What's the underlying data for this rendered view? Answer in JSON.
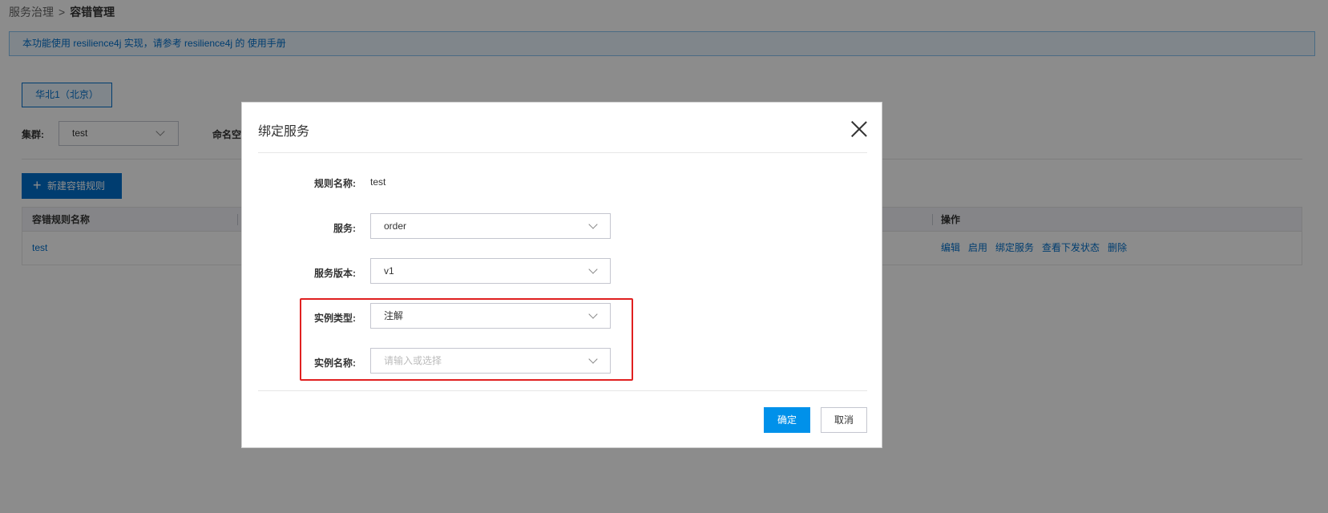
{
  "breadcrumb": {
    "parent": "服务治理",
    "separator": ">",
    "current": "容错管理"
  },
  "notice": {
    "text": "本功能使用 resilience4j 实现，请参考 resilience4j 的 使用手册"
  },
  "filters": {
    "region": "华北1（北京）",
    "cluster_label": "集群:",
    "cluster_value": "test",
    "namespace_label": "命名空"
  },
  "toolbar": {
    "create_label": "新建容错规则"
  },
  "table": {
    "headers": {
      "name": "容错规则名称",
      "actions": "操作"
    },
    "rows": [
      {
        "name": "test",
        "actions": [
          "编辑",
          "启用",
          "绑定服务",
          "查看下发状态",
          "删除"
        ]
      }
    ]
  },
  "dialog": {
    "title": "绑定服务",
    "rule_name": {
      "label": "规则名称:",
      "value": "test"
    },
    "service": {
      "label": "服务:",
      "value": "order"
    },
    "version": {
      "label": "服务版本:",
      "value": "v1"
    },
    "instance_type": {
      "label": "实例类型:",
      "value": "注解"
    },
    "instance_name": {
      "label": "实例名称:",
      "placeholder": "请输入或选择"
    },
    "ok_label": "确定",
    "cancel_label": "取消"
  },
  "colors": {
    "primary": "#0070cc",
    "confirm": "#0091ea",
    "highlight": "#e02020"
  }
}
